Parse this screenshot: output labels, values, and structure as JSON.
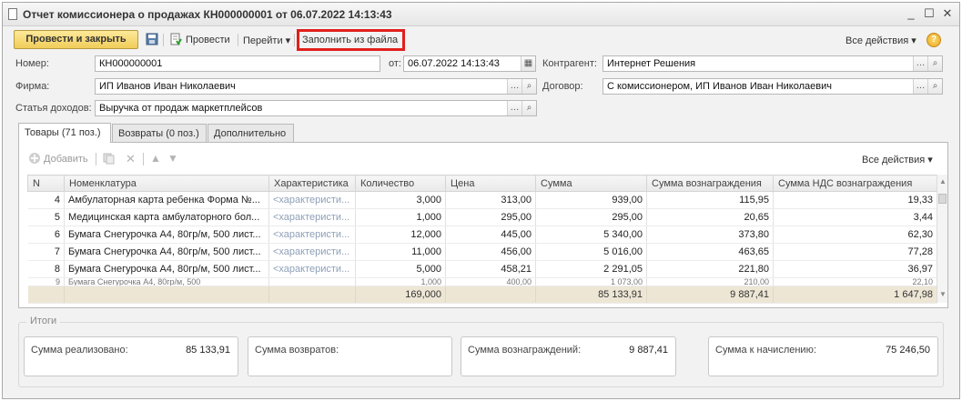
{
  "window": {
    "title": "Отчет комиссионера о продажах КН000000001 от 06.07.2022 14:13:43",
    "minimize_glyph": "_",
    "maximize_glyph": "☐",
    "close_glyph": "✕"
  },
  "toolbar": {
    "post_close_label": "Провести и закрыть",
    "post_label": "Провести",
    "goto_label": "Перейти",
    "fill_from_file_label": "Заполнить из файла",
    "all_actions_label": "Все действия",
    "help_glyph": "?",
    "highlight_color": "#e0201c"
  },
  "form": {
    "number_label": "Номер:",
    "number_value": "КН000000001",
    "date_label": "от:",
    "date_value": "06.07.2022 14:13:43",
    "counterparty_label": "Контрагент:",
    "counterparty_value": "Интернет Решения",
    "firm_label": "Фирма:",
    "firm_value": "ИП Иванов Иван Николаевич",
    "contract_label": "Договор:",
    "contract_value": "С комиссионером, ИП Иванов Иван Николаевич",
    "income_label": "Статья доходов:",
    "income_value": "Выручка от продаж маркетплейсов"
  },
  "tabs": [
    {
      "label": "Товары (71 поз.)"
    },
    {
      "label": "Возвраты (0 поз.)"
    },
    {
      "label": "Дополнительно"
    }
  ],
  "grid_toolbar": {
    "add_label": "Добавить",
    "all_actions_label": "Все действия"
  },
  "grid": {
    "headers": [
      "N",
      "Номенклатура",
      "Характеристика",
      "Количество",
      "Цена",
      "Сумма",
      "Сумма вознаграждения",
      "Сумма НДС вознаграждения"
    ],
    "rows": [
      {
        "n": "4",
        "name": "Амбулаторная карта ребенка Форма №...",
        "char": "<характеристи...",
        "qty": "3,000",
        "price": "313,00",
        "sum": "939,00",
        "reward": "115,95",
        "vat": "19,33"
      },
      {
        "n": "5",
        "name": "Медицинская карта амбулаторного бол...",
        "char": "<характеристи...",
        "qty": "1,000",
        "price": "295,00",
        "sum": "295,00",
        "reward": "20,65",
        "vat": "3,44"
      },
      {
        "n": "6",
        "name": "Бумага Снегурочка А4, 80гр/м, 500 лист...",
        "char": "<характеристи...",
        "qty": "12,000",
        "price": "445,00",
        "sum": "5 340,00",
        "reward": "373,80",
        "vat": "62,30"
      },
      {
        "n": "7",
        "name": "Бумага Снегурочка А4, 80гр/м, 500 лист...",
        "char": "<характеристи...",
        "qty": "11,000",
        "price": "456,00",
        "sum": "5 016,00",
        "reward": "463,65",
        "vat": "77,28"
      },
      {
        "n": "8",
        "name": "Бумага Снегурочка А4, 80гр/м, 500 лист...",
        "char": "<характеристи...",
        "qty": "5,000",
        "price": "458,21",
        "sum": "2 291,05",
        "reward": "221,80",
        "vat": "36,97"
      }
    ],
    "partial_row": {
      "n": "9",
      "name": "Бумага Снегурочка А4, 80гр/м, 500",
      "qty": "1,000",
      "price": "400,00",
      "sum": "1 073,00",
      "reward": "210,00",
      "vat": "22,10"
    },
    "totals": {
      "qty": "169,000",
      "sum": "85 133,91",
      "reward": "9 887,41",
      "vat": "1 647,98"
    }
  },
  "summary": {
    "legend": "Итоги",
    "sold_label": "Сумма реализовано:",
    "sold_value": "85 133,91",
    "returns_label": "Сумма возвратов:",
    "returns_value": "",
    "rewards_label": "Сумма вознаграждений:",
    "rewards_value": "9 887,41",
    "accrual_label": "Сумма к начислению:",
    "accrual_value": "75 246,50"
  }
}
